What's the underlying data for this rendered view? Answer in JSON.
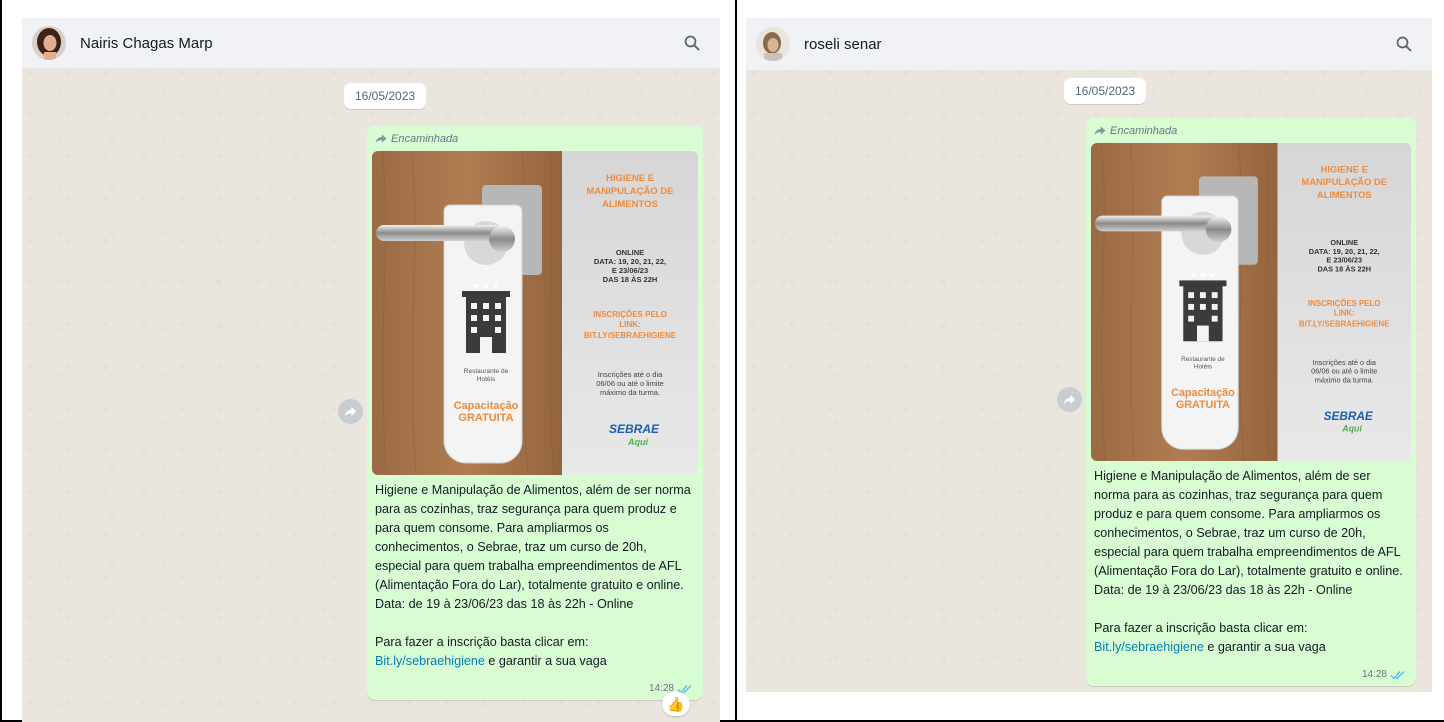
{
  "panels": [
    {
      "contact_name": "Nairis Chagas Marp",
      "date": "16/05/2023",
      "forwarded_label": "Encaminhada",
      "time": "14:28",
      "reaction": "👍"
    },
    {
      "contact_name": "roseli senar",
      "date": "16/05/2023",
      "forwarded_label": "Encaminhada",
      "time": "14:28"
    }
  ],
  "flyer": {
    "title": [
      "HIGIENE E",
      "MANIPULAÇÃO DE",
      "ALIMENTOS"
    ],
    "online": [
      "ONLINE",
      "DATA: 19, 20, 21, 22,",
      "E 23/06/23",
      "DAS 18 ÀS 22H"
    ],
    "inscricoes": [
      "INSCRIÇÕES PELO",
      "LINK:",
      "BIT.LY/SEBRAEHIGIENE"
    ],
    "limit": [
      "Inscrições até o dia",
      "06/06 ou até o limite",
      "máximo da turma."
    ],
    "hanger_label": [
      "Restaurante de",
      "Hotéis"
    ],
    "badge": [
      "Capacitação",
      "GRATUITA"
    ],
    "logo_main": "SEBRAE",
    "logo_sub": "Aqui"
  },
  "message": {
    "body": "Higiene e Manipulação de Alimentos, além de ser norma para as cozinhas, traz segurança para quem produz e para quem consome. Para ampliarmos os conhecimentos, o Sebrae, traz um curso de 20h, especial para quem trabalha empreendimentos de AFL (Alimentação Fora do Lar), totalmente gratuito e online.",
    "date_line": "Data: de 19 à 23/06/23 das 18 às 22h - Online",
    "cta": "Para fazer a inscrição basta clicar em:",
    "link": "Bit.ly/sebraehigiene",
    "link_suffix": " e garantir a sua vaga"
  },
  "colors": {
    "bubble": "#d9fdd3",
    "link": "#027eb5",
    "orange": "#f08a3c",
    "sebrae_blue": "#1a5fb4",
    "read_ticks": "#53bdeb"
  }
}
